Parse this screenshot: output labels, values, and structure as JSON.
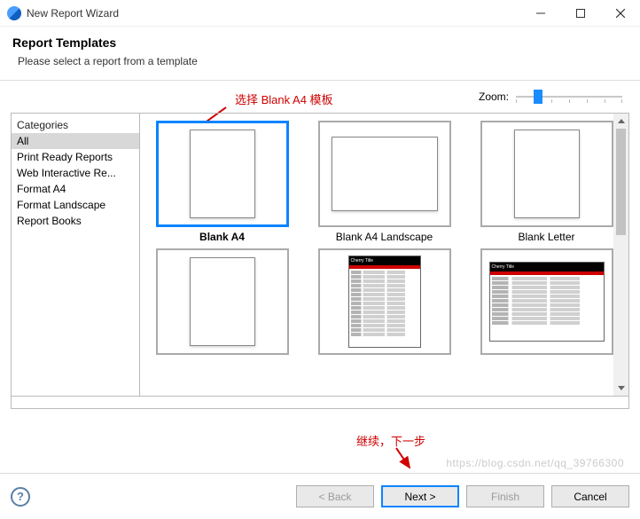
{
  "window": {
    "title": "New Report Wizard"
  },
  "header": {
    "title": "Report Templates",
    "subtitle": "Please select a report from a template"
  },
  "annotations": {
    "select_template": "选择 Blank A4 模板",
    "continue_next": "继续，下一步"
  },
  "zoom": {
    "label": "Zoom:"
  },
  "sidebar": {
    "header": "Categories",
    "items": [
      {
        "label": "All",
        "selected": true
      },
      {
        "label": "Print Ready Reports",
        "selected": false
      },
      {
        "label": "Web Interactive Re...",
        "selected": false
      },
      {
        "label": "Format A4",
        "selected": false
      },
      {
        "label": "Format Landscape",
        "selected": false
      },
      {
        "label": "Report Books",
        "selected": false
      }
    ]
  },
  "templates": [
    {
      "label": "Blank A4",
      "kind": "blank-portrait",
      "selected": true
    },
    {
      "label": "Blank A4 Landscape",
      "kind": "blank-landscape",
      "selected": false
    },
    {
      "label": "Blank Letter",
      "kind": "blank-portrait",
      "selected": false
    },
    {
      "label": "",
      "kind": "blank-portrait",
      "selected": false
    },
    {
      "label": "",
      "kind": "cherry-portrait",
      "selected": false
    },
    {
      "label": "",
      "kind": "cherry-landscape",
      "selected": false
    }
  ],
  "cherry": {
    "title": "Cherry Title"
  },
  "buttons": {
    "back": "< Back",
    "next": "Next >",
    "finish": "Finish",
    "cancel": "Cancel"
  },
  "watermark": "https://blog.csdn.net/qq_39766300"
}
